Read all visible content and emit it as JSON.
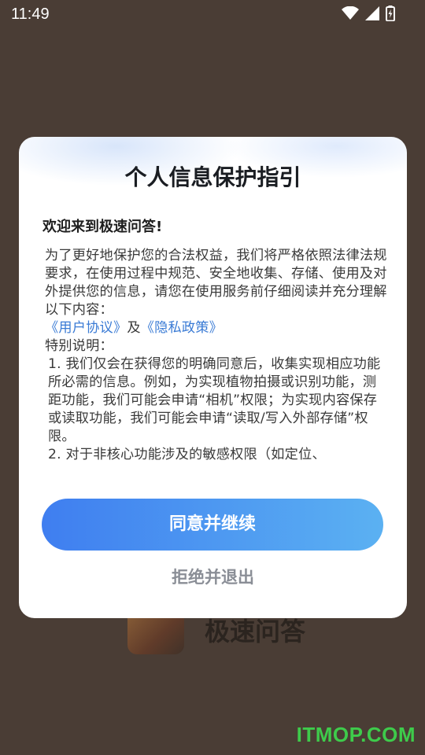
{
  "status_bar": {
    "time": "11:49",
    "icons": [
      "wifi-icon",
      "cell-signal-icon",
      "battery-charging-icon"
    ]
  },
  "background_app": {
    "name": "极速问答"
  },
  "dialog": {
    "title": "个人信息保护指引",
    "welcome": "欢迎来到极速问答!",
    "intro": "为了更好地保护您的合法权益，我们将严格依照法律法规要求，在使用过程中规范、安全地收集、存储、使用及对外提供您的信息，请您在使用服务前仔细阅读并充分理解以下内容：",
    "user_agreement_link": "《用户协议》",
    "and_text": "及",
    "privacy_policy_link": "《隐私政策》",
    "special_note": "特别说明：",
    "item1": "1. 我们仅会在获得您的明确同意后，收集实现相应功能所必需的信息。例如，为实现植物拍摄或识别功能，测距功能，我们可能会申请“相机”权限；为实现内容保存或读取功能，我们可能会申请“读取/写入外部存储”权限。",
    "item2": "2. 对于非核心功能涉及的敏感权限（如定位、",
    "agree_button": "同意并继续",
    "reject_button": "拒绝并退出"
  },
  "watermark": "ITMOP.COM",
  "colors": {
    "link": "#3a7bd5",
    "button_gradient_start": "#3f7ef0",
    "button_gradient_end": "#5bb1f2",
    "watermark": "#3ecb4b"
  }
}
